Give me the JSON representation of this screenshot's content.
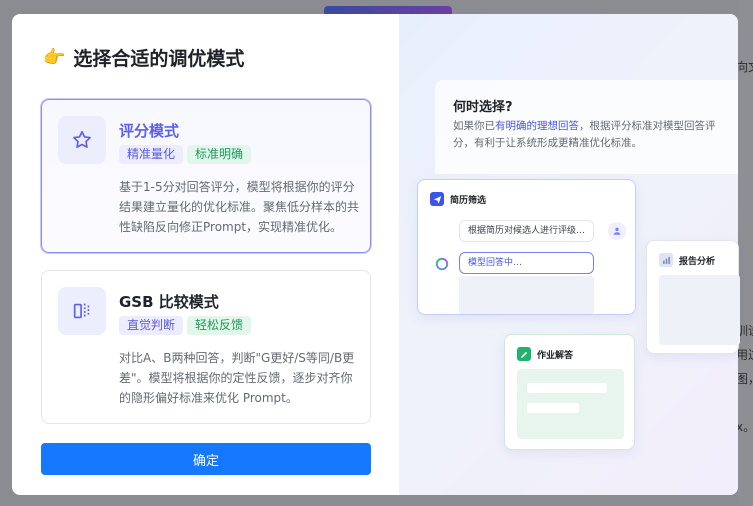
{
  "background": {
    "side_text_fragments": [
      "向文",
      "训说",
      "用过",
      "图，",
      "x。"
    ]
  },
  "modal": {
    "title": "选择合适的调优模式",
    "title_icon": "pointing-hand-emoji",
    "title_emoji": "👉",
    "options": [
      {
        "name": "评分模式",
        "icon": "star-icon",
        "selected": true,
        "tags": [
          "精准量化",
          "标准明确"
        ],
        "description": "基于1-5分对回答评分，模型将根据你的评分结果建立量化的优化标准。聚焦低分样本的共性缺陷反向修正Prompt，实现精准优化。"
      },
      {
        "name": "GSB 比较模式",
        "icon": "compare-columns-icon",
        "selected": false,
        "tags": [
          "直觉判断",
          "轻松反馈"
        ],
        "description": "对比A、B两种回答，判断\"G更好/S等同/B更差\"。模型将根据你的定性反馈，逐步对齐你的隐形偏好标准来优化 Prompt。"
      }
    ],
    "confirm_label": "确定"
  },
  "info": {
    "title": "何时选择?",
    "desc_prefix": "如果你已",
    "desc_highlight": "有明确的理想回答",
    "desc_suffix": "，根据评分标准对模型回答评分，有利于让系统形成更精准优化标准。"
  },
  "illustration": {
    "resume": {
      "title": "简历筛选",
      "user_message": "根据简历对候选人进行评级…",
      "model_reply": "模型回答中…"
    },
    "report": {
      "title": "报告分析"
    },
    "homework": {
      "title": "作业解答"
    }
  },
  "colors": {
    "accent": "#5d5ff0",
    "confirm": "#1677ff",
    "tag_green": "#1e9a58"
  }
}
